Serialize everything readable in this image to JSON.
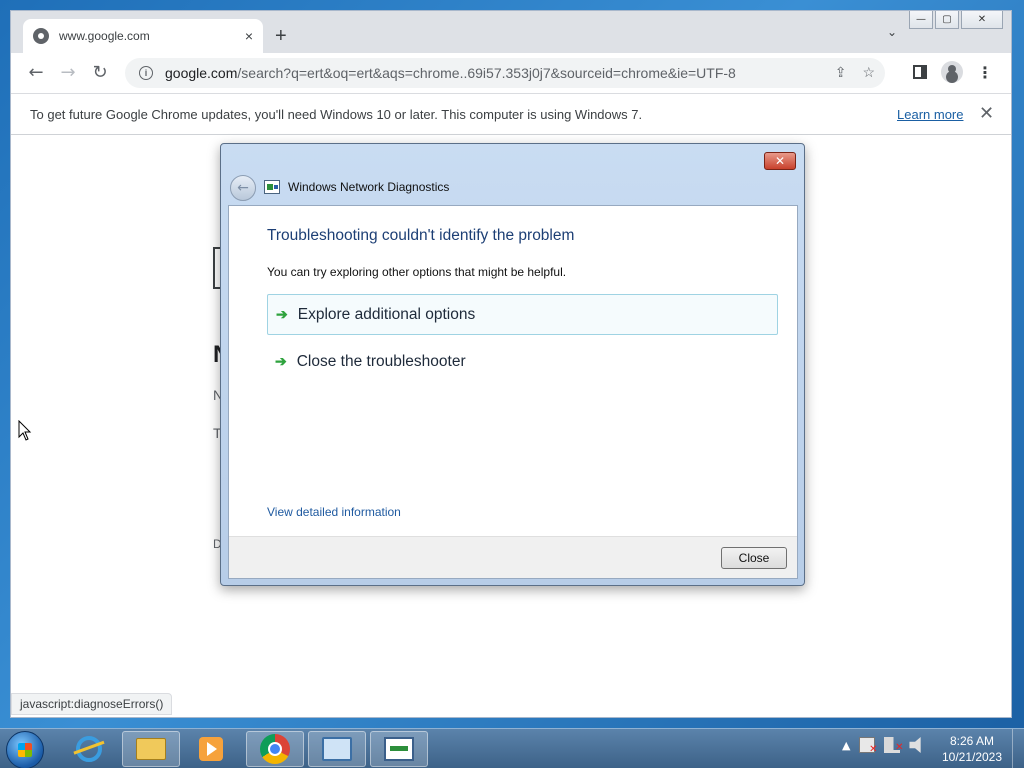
{
  "browser": {
    "tab_title": "www.google.com",
    "tab_close": "×",
    "new_tab": "+",
    "tab_search": "⌄",
    "window_controls": {
      "minimize": "—",
      "restore": "▢",
      "close": "✕"
    },
    "nav": {
      "back": "←",
      "forward": "→",
      "reload": "↻"
    },
    "address": {
      "host": "google.com",
      "rest": "/search?q=ert&oq=ert&aqs=chrome..69i57.353j0j7&sourceid=chrome&ie=UTF-8"
    },
    "toolbar_icons": {
      "share": "⇪",
      "bookmark": "☆",
      "menu": "⋮"
    },
    "infobar": {
      "message": "To get future Google Chrome updates, you'll need Windows 10 or later. This computer is using Windows 7.",
      "link": "Learn more",
      "close": "✕"
    },
    "page_fragments": {
      "n_heading": "N",
      "n_line": "N",
      "t_line": "T",
      "d_line": "D"
    },
    "status_text": "javascript:diagnoseErrors()"
  },
  "dialog": {
    "title": "Windows Network Diagnostics",
    "close_glyph": "✕",
    "back_glyph": "←",
    "heading": "Troubleshooting couldn't identify the problem",
    "subtext": "You can try exploring other options that might be helpful.",
    "options": [
      {
        "label": "Explore additional options"
      },
      {
        "label": "Close the troubleshooter"
      }
    ],
    "option_arrow": "➔",
    "details_link": "View detailed information",
    "close_button": "Close"
  },
  "taskbar": {
    "clock_time": "8:26 AM",
    "clock_date": "10/21/2023",
    "tray_expand": "▲",
    "error_mark": "✕"
  }
}
